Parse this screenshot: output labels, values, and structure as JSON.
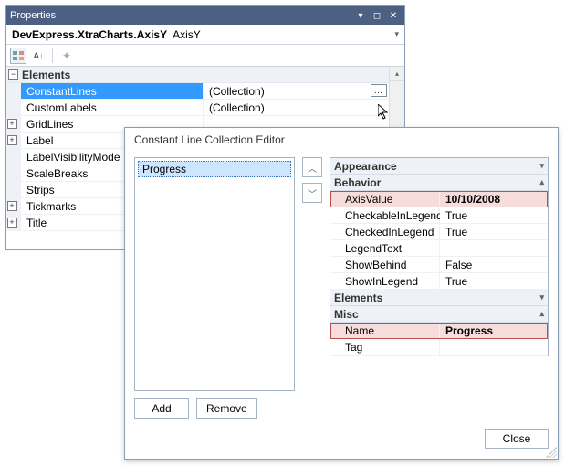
{
  "propWin": {
    "title": "Properties",
    "objectType": "DevExpress.XtraCharts.AxisY",
    "objectName": "AxisY",
    "category": "Elements",
    "rows": [
      {
        "name": "ConstantLines",
        "value": "(Collection)",
        "selected": true,
        "hasEllipsis": true,
        "expandable": false
      },
      {
        "name": "CustomLabels",
        "value": "(Collection)",
        "selected": false,
        "expandable": false
      },
      {
        "name": "GridLines",
        "value": "",
        "expandable": true
      },
      {
        "name": "Label",
        "value": "",
        "expandable": true
      },
      {
        "name": "LabelVisibilityMode",
        "value": "",
        "expandable": false
      },
      {
        "name": "ScaleBreaks",
        "value": "",
        "expandable": false
      },
      {
        "name": "Strips",
        "value": "",
        "expandable": false
      },
      {
        "name": "Tickmarks",
        "value": "",
        "expandable": true
      },
      {
        "name": "Title",
        "value": "",
        "expandable": true
      }
    ]
  },
  "editor": {
    "title": "Constant Line Collection Editor",
    "listItems": [
      "Progress"
    ],
    "add": "Add",
    "remove": "Remove",
    "close": "Close",
    "categories": {
      "appearance": "Appearance",
      "behavior": "Behavior",
      "elements": "Elements",
      "misc": "Misc"
    },
    "behavior": {
      "axisValueLabel": "AxisValue",
      "axisValue": "10/10/2008",
      "checkableLabel": "CheckableInLegend",
      "checkable": "True",
      "checkedLabel": "CheckedInLegend",
      "checked": "True",
      "legendTextLabel": "LegendText",
      "legendText": "",
      "showBehindLabel": "ShowBehind",
      "showBehind": "False",
      "showInLegendLabel": "ShowInLegend",
      "showInLegend": "True"
    },
    "misc": {
      "nameLabel": "Name",
      "name": "Progress",
      "tagLabel": "Tag",
      "tag": ""
    }
  }
}
